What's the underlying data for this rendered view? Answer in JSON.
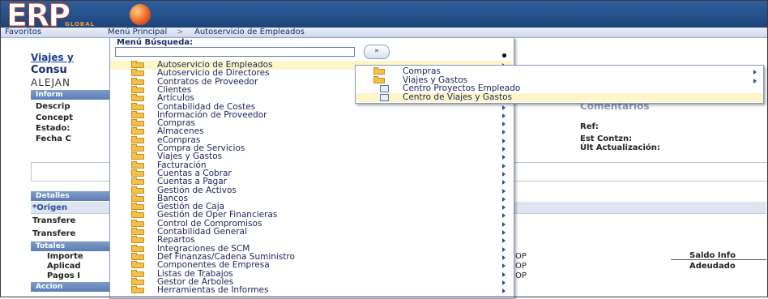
{
  "header": {
    "logo_text": "ERP",
    "logo_sub": "GLOBAL"
  },
  "navbar": {
    "favorites": "Favoritos",
    "main_menu": "Menú Principal",
    "separator": ">",
    "current": "Autoservicio de Empleados"
  },
  "background": {
    "link": "Viajes y",
    "title": "Consu",
    "user_name": "ALEJAN",
    "info_bar": "Inform",
    "fields": [
      "Descrip",
      "Concept",
      "Estado:",
      "Fecha C"
    ],
    "comments_label": "Comentarios",
    "ref_label": "Ref:",
    "est_label": "Est Contzn:",
    "ult_label": "Últ Actualización:",
    "details_bar": "Detalles",
    "origin_label": "*Origen",
    "transfer_rows": [
      "Transfere",
      "Transfere"
    ],
    "totals_bar": "Totales",
    "totals_labels": [
      "Importe",
      "Aplicad",
      "Pagos I"
    ],
    "actions_bar": "Accion",
    "currency_codes": [
      "OP",
      "OP",
      "OP"
    ],
    "saldo_label": "Saldo Info",
    "adeudado_label": "Adeudado"
  },
  "menu": {
    "search_label": "Menú Búsqueda:",
    "search_value": "",
    "go_label": "»",
    "items": [
      {
        "label": "Autoservicio de Empleados",
        "highlighted": true
      },
      {
        "label": "Autoservicio de Directores"
      },
      {
        "label": "Contratos de Proveedor"
      },
      {
        "label": "Clientes"
      },
      {
        "label": "Artículos"
      },
      {
        "label": "Contabilidad de Costes"
      },
      {
        "label": "Información de Proveedor"
      },
      {
        "label": "Compras"
      },
      {
        "label": "Almacenes"
      },
      {
        "label": "eCompras"
      },
      {
        "label": "Compra de Servicios"
      },
      {
        "label": "Viajes y Gastos"
      },
      {
        "label": "Facturación"
      },
      {
        "label": "Cuentas a Cobrar"
      },
      {
        "label": "Cuentas a Pagar"
      },
      {
        "label": "Gestión de Activos"
      },
      {
        "label": "Bancos"
      },
      {
        "label": "Gestión de Caja"
      },
      {
        "label": "Gestión de Oper Financieras"
      },
      {
        "label": "Control de Compromisos"
      },
      {
        "label": "Contabilidad General"
      },
      {
        "label": "Repartos"
      },
      {
        "label": "Integraciones de SCM"
      },
      {
        "label": "Def Finanzas/Cadena Suministro"
      },
      {
        "label": "Componentes de Empresa"
      },
      {
        "label": "Listas de Trabajos"
      },
      {
        "label": "Gestor de Árboles"
      },
      {
        "label": "Herramientas de Informes"
      }
    ]
  },
  "submenu": {
    "items": [
      {
        "label": "Compras",
        "type": "folder",
        "has_arrow": true
      },
      {
        "label": "Viajes y Gastos",
        "type": "folder",
        "has_arrow": true
      },
      {
        "label": "Centro Proyectos Empleado",
        "type": "page"
      },
      {
        "label": "Centro de Viajes y Gastos",
        "type": "page",
        "highlighted": true
      }
    ]
  }
}
